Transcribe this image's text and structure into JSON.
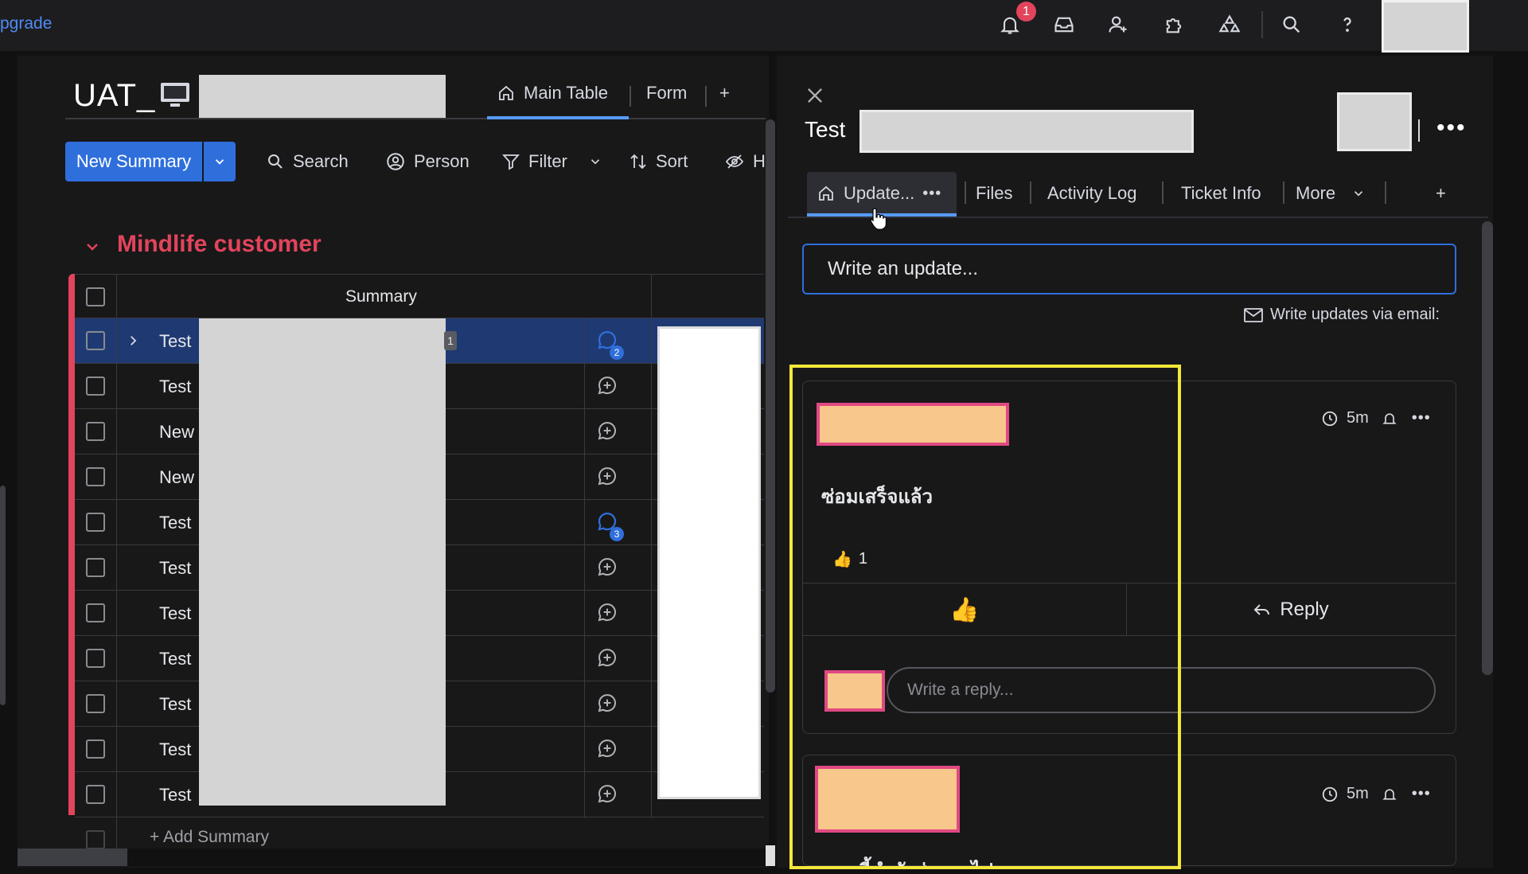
{
  "topbar": {
    "upgrade_label": "pgrade",
    "notification_count": "1",
    "icons": [
      "bell-icon",
      "inbox-icon",
      "invite-user-icon",
      "apps-icon",
      "integrations-icon",
      "search-icon",
      "help-icon"
    ]
  },
  "board": {
    "title": "UAT_",
    "views": {
      "main_table": "Main Table",
      "form": "Form",
      "add": "+"
    },
    "toolbar": {
      "new_item": "New Summary",
      "search": "Search",
      "person": "Person",
      "filter": "Filter",
      "sort": "Sort",
      "hide": "H"
    },
    "group": {
      "title": "Mindlife customer",
      "color": "#e2445c",
      "column_header": "Summary",
      "rows": [
        {
          "name": "Test",
          "updates": "2",
          "selected": true,
          "subitems": "1"
        },
        {
          "name": "Test",
          "updates": ""
        },
        {
          "name": "New",
          "updates": ""
        },
        {
          "name": "New",
          "updates": ""
        },
        {
          "name": "Test",
          "updates": "3"
        },
        {
          "name": "Test",
          "updates": ""
        },
        {
          "name": "Test",
          "updates": ""
        },
        {
          "name": "Test",
          "updates": ""
        },
        {
          "name": "Test",
          "updates": ""
        },
        {
          "name": "Test",
          "updates": ""
        },
        {
          "name": "Test",
          "updates": ""
        }
      ],
      "add_item": "+ Add Summary"
    }
  },
  "panel": {
    "title": "Test",
    "tabs": {
      "updates": "Update...",
      "files": "Files",
      "activity": "Activity Log",
      "ticket": "Ticket Info",
      "more": "More",
      "add": "+"
    },
    "write_update_placeholder": "Write an update...",
    "email_link": "Write updates via email:",
    "posts": [
      {
        "time": "5m",
        "text": "ซ่อมเสร็จแล้ว",
        "likes": "1",
        "reply_label": "Reply",
        "reply_placeholder": "Write a reply..."
      },
      {
        "time": "5m",
        "text": "ตอนนี้กำลังส่งตามไปนะ"
      }
    ]
  },
  "colors": {
    "accent": "#2f6fdc",
    "tab_underline": "#579bfc",
    "highlight": "#f3e73a",
    "redaction": "#d4d4d4",
    "avatar_redaction_fill": "#f7c78b",
    "avatar_redaction_border": "#e04983"
  }
}
